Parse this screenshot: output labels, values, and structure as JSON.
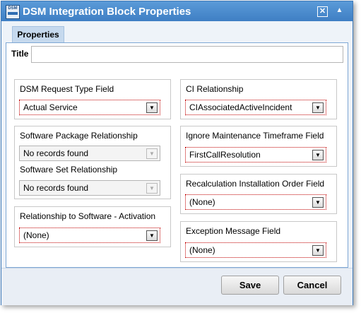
{
  "window": {
    "title": "DSM Integration Block Properties",
    "icon_text": "DSM",
    "close_glyph": "✕",
    "collapse_glyph": "▲"
  },
  "tabs": [
    {
      "label": "Properties"
    }
  ],
  "title_field": {
    "label": "Title",
    "value": ""
  },
  "dropdown_arrow": "▼",
  "left": {
    "request_type": {
      "label": "DSM Request Type Field",
      "value": "Actual Service"
    },
    "software_package": {
      "label": "Software Package Relationship",
      "value": "No records found"
    },
    "software_set": {
      "label": "Software Set Relationship",
      "value": "No records found"
    },
    "activation": {
      "label": "Relationship to Software - Activation",
      "value": "(None)"
    }
  },
  "right": {
    "ci_relationship": {
      "label": "CI Relationship",
      "value": "CIAssociatedActiveIncident"
    },
    "ignore_maintenance": {
      "label": "Ignore Maintenance Timeframe Field",
      "value": "FirstCallResolution"
    },
    "recalculation": {
      "label": "Recalculation Installation Order Field",
      "value": "(None)"
    },
    "exception_message": {
      "label": "Exception Message Field",
      "value": "(None)"
    }
  },
  "buttons": {
    "save": "Save",
    "cancel": "Cancel"
  }
}
